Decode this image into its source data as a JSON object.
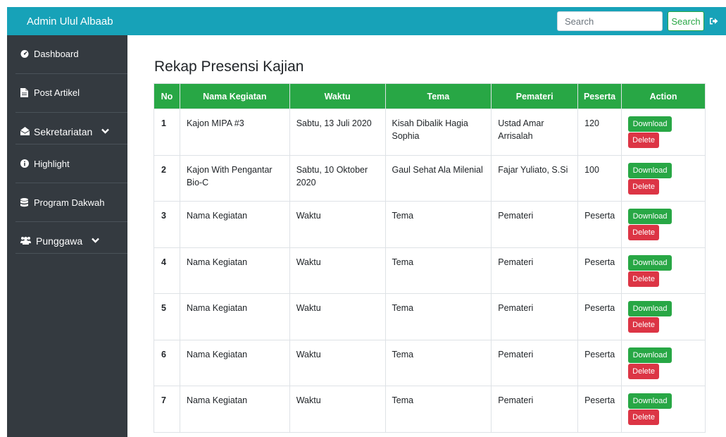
{
  "topbar": {
    "brand": "Admin Ulul Albaab",
    "search_placeholder": "Search",
    "search_button": "Search"
  },
  "sidebar": {
    "items": [
      {
        "label": "Dashboard",
        "icon": "tachometer-icon"
      },
      {
        "label": "Post Artikel",
        "icon": "file-icon"
      },
      {
        "label": "Sekretariatan",
        "icon": "envelope-open-icon",
        "dropdown": true
      },
      {
        "label": "Highlight",
        "icon": "info-circle-icon"
      },
      {
        "label": "Program Dakwah",
        "icon": "database-icon"
      },
      {
        "label": "Punggawa",
        "icon": "users-icon",
        "dropdown": true
      }
    ]
  },
  "page": {
    "title": "Rekap Presensi Kajian"
  },
  "table": {
    "headers": [
      "No",
      "Nama Kegiatan",
      "Waktu",
      "Tema",
      "Pemateri",
      "Peserta",
      "Action"
    ],
    "download_label": "Download",
    "delete_label": "Delete",
    "rows": [
      {
        "no": "1",
        "nama": "Kajon MIPA #3",
        "waktu": "Sabtu, 13 Juli 2020",
        "tema": "Kisah Dibalik Hagia Sophia",
        "pemateri": "Ustad Amar Arrisalah",
        "peserta": "120"
      },
      {
        "no": "2",
        "nama": "Kajon With Pengantar Bio-C",
        "waktu": "Sabtu, 10 Oktober 2020",
        "tema": "Gaul Sehat Ala Milenial",
        "pemateri": "Fajar Yuliato, S.Si",
        "peserta": "100"
      },
      {
        "no": "3",
        "nama": "Nama Kegiatan",
        "waktu": "Waktu",
        "tema": "Tema",
        "pemateri": "Pemateri",
        "peserta": "Peserta"
      },
      {
        "no": "4",
        "nama": "Nama Kegiatan",
        "waktu": "Waktu",
        "tema": "Tema",
        "pemateri": "Pemateri",
        "peserta": "Peserta"
      },
      {
        "no": "5",
        "nama": "Nama Kegiatan",
        "waktu": "Waktu",
        "tema": "Tema",
        "pemateri": "Pemateri",
        "peserta": "Peserta"
      },
      {
        "no": "6",
        "nama": "Nama Kegiatan",
        "waktu": "Waktu",
        "tema": "Tema",
        "pemateri": "Pemateri",
        "peserta": "Peserta"
      },
      {
        "no": "7",
        "nama": "Nama Kegiatan",
        "waktu": "Waktu",
        "tema": "Tema",
        "pemateri": "Pemateri",
        "peserta": "Peserta"
      }
    ]
  },
  "colors": {
    "topbar": "#17a2b8",
    "sidebar": "#343a40",
    "header": "#28a745",
    "download": "#28a745",
    "delete": "#dc3545"
  }
}
